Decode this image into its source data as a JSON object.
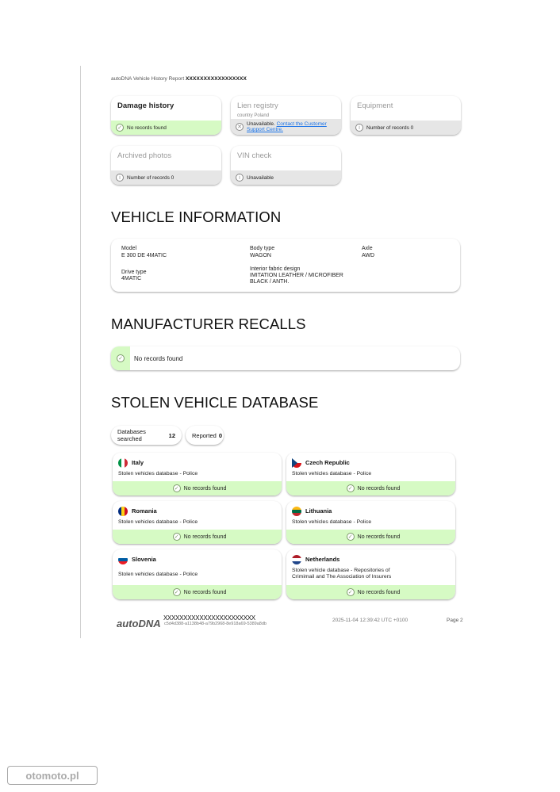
{
  "header": {
    "prefix": "autoDNA Vehicle History Report",
    "vin": "XXXXXXXXXXXXXXXXX"
  },
  "summary_cards": [
    {
      "title": "Damage history",
      "status": "No records found"
    },
    {
      "title": "Lien registry",
      "subtitle": "country Poland",
      "status": "Unavailable.",
      "link": "Contact the Customer Support Centre."
    },
    {
      "title": "Equipment",
      "status": "Number of records 0"
    },
    {
      "title": "Archived photos",
      "status": "Number of records 0"
    },
    {
      "title": "VIN check",
      "status": "Unavailable"
    }
  ],
  "vehicle_information": {
    "heading": "VEHICLE INFORMATION",
    "model_label": "Model",
    "model_value": "E 300 DE 4MATIC",
    "body_label": "Body type",
    "body_value": "WAGON",
    "axle_label": "Axle",
    "axle_value": "AWD",
    "drive_label": "Drive type",
    "drive_value": "4MATIC",
    "interior_label": "Interior fabric design",
    "interior_value_1": "IMITATION LEATHER / MICROFIBER",
    "interior_value_2": "BLACK / ANTH."
  },
  "recalls": {
    "heading": "MANUFACTURER RECALLS",
    "status": "No records found"
  },
  "stolen": {
    "heading": "STOLEN VEHICLE DATABASE",
    "searched_label": "Databases searched",
    "searched_count": "12",
    "reported_label": "Reported",
    "reported_count": "0",
    "cards": [
      {
        "country": "Italy",
        "desc": "Stolen vehicles database - Police",
        "status": "No records found"
      },
      {
        "country": "Czech Republic",
        "desc": "Stolen vehicles database - Police",
        "status": "No records found"
      },
      {
        "country": "Romania",
        "desc": "Stolen vehicles database - Police",
        "status": "No records found"
      },
      {
        "country": "Lithuania",
        "desc": "Stolen vehicles database - Police",
        "status": "No records found"
      },
      {
        "country": "Slovenia",
        "desc": "Stolen vehicles database - Police",
        "status": "No records found"
      },
      {
        "country": "Netherlands",
        "desc": "Stolen vehicle database - Repositories of Crimimail and The Association of Insurers",
        "status": "No records found"
      }
    ]
  },
  "footer": {
    "logo": "autoDNA",
    "id": "XXXXXXXXXXXXXXXXXXXXXXX",
    "hash": "c5d4d388-a1138b48-a79b2968-8e918a69-5389a8db",
    "date": "2025-11-04 12:39:42 UTC +0100",
    "page": "Page 2"
  },
  "watermark": "otomoto.pl",
  "colors": {
    "ok_strip": "#d6fac4",
    "neutral_strip": "#e6e6e6",
    "link": "#1a73e8"
  }
}
